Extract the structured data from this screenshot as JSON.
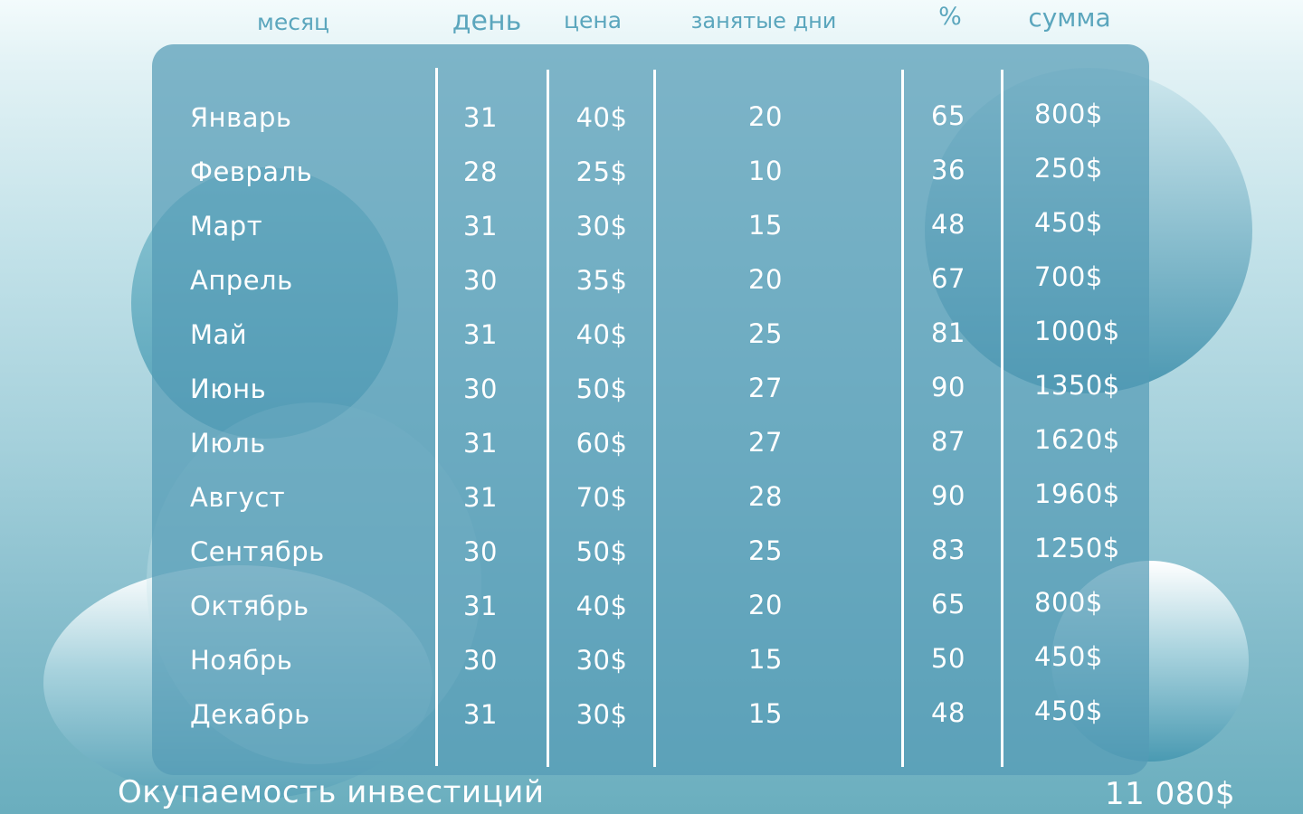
{
  "headers": {
    "month": "месяц",
    "day": "день",
    "price": "цена",
    "busy_days": "занятые дни",
    "percent": "%",
    "sum": "сумма"
  },
  "rows": [
    {
      "month": "Январь",
      "days": "31",
      "price": "40$",
      "busy": "20",
      "percent": "65",
      "sum": "800$"
    },
    {
      "month": "Февраль",
      "days": "28",
      "price": "25$",
      "busy": "10",
      "percent": "36",
      "sum": "250$"
    },
    {
      "month": "Март",
      "days": "31",
      "price": "30$",
      "busy": "15",
      "percent": "48",
      "sum": "450$"
    },
    {
      "month": "Апрель",
      "days": "30",
      "price": "35$",
      "busy": "20",
      "percent": "67",
      "sum": "700$"
    },
    {
      "month": "Май",
      "days": "31",
      "price": "40$",
      "busy": "25",
      "percent": "81",
      "sum": "1000$"
    },
    {
      "month": "Июнь",
      "days": "30",
      "price": "50$",
      "busy": "27",
      "percent": "90",
      "sum": "1350$"
    },
    {
      "month": "Июль",
      "days": "31",
      "price": "60$",
      "busy": "27",
      "percent": "87",
      "sum": "1620$"
    },
    {
      "month": "Август",
      "days": "31",
      "price": "70$",
      "busy": "28",
      "percent": "90",
      "sum": "1960$"
    },
    {
      "month": "Сентябрь",
      "days": "30",
      "price": "50$",
      "busy": "25",
      "percent": "83",
      "sum": "1250$"
    },
    {
      "month": "Октябрь",
      "days": "31",
      "price": "40$",
      "busy": "20",
      "percent": "65",
      "sum": "800$"
    },
    {
      "month": "Ноябрь",
      "days": "30",
      "price": "30$",
      "busy": "15",
      "percent": "50",
      "sum": "450$"
    },
    {
      "month": "Декабрь",
      "days": "31",
      "price": "30$",
      "busy": "15",
      "percent": "48",
      "sum": "450$"
    }
  ],
  "footer": {
    "label": "Окупаемость инвестиций",
    "total": "11 080$"
  },
  "colors": {
    "header_text": "#5ba6bd",
    "card_fill": "#549bb6",
    "text": "#ffffff"
  }
}
